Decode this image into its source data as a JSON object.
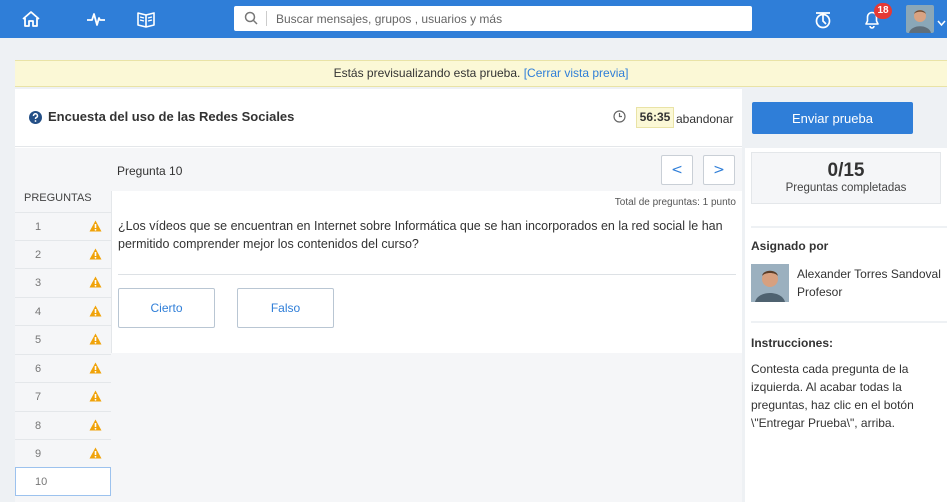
{
  "topbar": {
    "search_placeholder": "Buscar mensajes, grupos , usuarios y más",
    "notifications_count": "18",
    "colors": {
      "bar": "#2f7ed8",
      "badge": "#e53935"
    }
  },
  "banner": {
    "text": "Estás previsualizando esta prueba. ",
    "link": "[Cerrar vista previa]"
  },
  "quiz": {
    "title": "Encuesta del uso de las Redes Sociales",
    "timer": "56:35",
    "abandon_label": "abandonar"
  },
  "questions_panel": {
    "header": "PREGUNTAS",
    "items": [
      {
        "label": "1",
        "warning": true
      },
      {
        "label": "2",
        "warning": true
      },
      {
        "label": "3",
        "warning": true
      },
      {
        "label": "4",
        "warning": true
      },
      {
        "label": "5",
        "warning": true
      },
      {
        "label": "6",
        "warning": true
      },
      {
        "label": "7",
        "warning": true
      },
      {
        "label": "8",
        "warning": true
      },
      {
        "label": "9",
        "warning": true
      },
      {
        "label": "10",
        "warning": false
      }
    ]
  },
  "question": {
    "number_label": "Pregunta 10",
    "prev_label": "<",
    "next_label": ">",
    "total_label": "Total de preguntas: 1 punto",
    "text": "¿Los vídeos que se encuentran en Internet sobre Informática que se han incorporados en la red social le han permitido comprender mejor los contenidos del curso?",
    "answers": [
      "Cierto",
      "Falso"
    ]
  },
  "sidebar": {
    "send_label": "Enviar prueba",
    "progress": "0/15",
    "progress_label": "Preguntas completadas",
    "assigned_head": "Asignado por",
    "author_name": "Alexander Torres Sandoval",
    "author_role": "Profesor",
    "instructions_head": "Instrucciones:",
    "instructions": "Contesta cada pregunta de la izquierda. Al acabar todas la preguntas, haz clic en el botón \\\"Entregar Prueba\\\", arriba."
  }
}
